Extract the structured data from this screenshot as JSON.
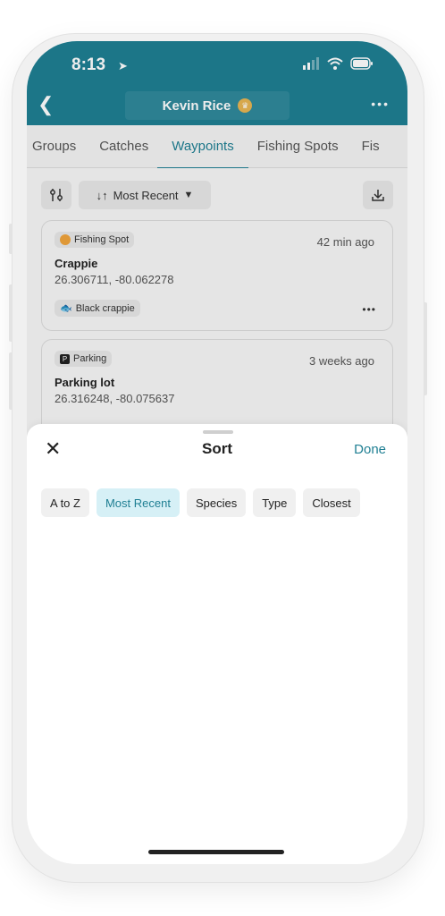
{
  "status": {
    "time": "8:13"
  },
  "header": {
    "title": "Kevin Rice",
    "more": "•••"
  },
  "tabs": [
    "Groups",
    "Catches",
    "Waypoints",
    "Fishing Spots",
    "Fis"
  ],
  "active_tab_index": 2,
  "toolbar": {
    "sort_label": "Most Recent"
  },
  "cards": [
    {
      "type": "Fishing Spot",
      "time": "42 min ago",
      "name": "Crappie",
      "coords": "26.306711, -80.062278",
      "species": "Black crappie"
    },
    {
      "type": "Parking",
      "time": "3 weeks ago",
      "name": "Parking lot",
      "coords": "26.316248, -80.075637"
    }
  ],
  "sheet": {
    "title": "Sort",
    "done": "Done",
    "options": [
      "A to Z",
      "Most Recent",
      "Species",
      "Type",
      "Closest"
    ],
    "selected_index": 1
  },
  "colors": {
    "accent": "#1f7f93",
    "selected_bg": "#d6f0f6"
  }
}
